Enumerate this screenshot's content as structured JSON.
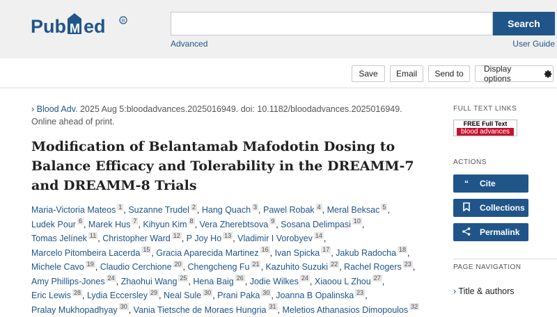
{
  "header": {
    "logo_text": "PubMed",
    "search_placeholder": "",
    "search_button": "Search",
    "advanced_link": "Advanced",
    "user_guide_link": "User Guide"
  },
  "toolbar": {
    "save": "Save",
    "email": "Email",
    "send_to": "Send to",
    "display_options": "Display options"
  },
  "citation": {
    "journal": "Blood Adv.",
    "details": " 2025 Aug 5:bloodadvances.2025016949. doi: 10.1182/bloodadvances.2025016949.",
    "status": "Online ahead of print."
  },
  "article": {
    "title": "Modification of Belantamab Mafodotin Dosing to Balance Efficacy and Tolerability in the DREAMM-7 and DREAMM-8 Trials",
    "authors": [
      {
        "name": "Maria-Victoria Mateos",
        "aff": "1"
      },
      {
        "name": "Suzanne Trudel",
        "aff": "2"
      },
      {
        "name": "Hang Quach",
        "aff": "3"
      },
      {
        "name": "Pawel Robak",
        "aff": "4"
      },
      {
        "name": "Meral Beksac",
        "aff": "5"
      },
      {
        "name": "Ludek Pour",
        "aff": "6"
      },
      {
        "name": "Marek Hus",
        "aff": "7"
      },
      {
        "name": "Kihyun Kim",
        "aff": "8"
      },
      {
        "name": "Vera Zherebtsova",
        "aff": "9"
      },
      {
        "name": "Sosana Delimpasi",
        "aff": "10"
      },
      {
        "name": "Tomas Jelínek",
        "aff": "11"
      },
      {
        "name": "Christopher Ward",
        "aff": "12"
      },
      {
        "name": "P Joy Ho",
        "aff": "13"
      },
      {
        "name": "Vladimir I Vorobyev",
        "aff": "14"
      },
      {
        "name": "Marcelo Pitombeira Lacerda",
        "aff": "15"
      },
      {
        "name": "Gracia Aparecida Martinez",
        "aff": "16"
      },
      {
        "name": "Ivan Spicka",
        "aff": "17"
      },
      {
        "name": "Jakub Radocha",
        "aff": "18"
      },
      {
        "name": "Michele Cavo",
        "aff": "19"
      },
      {
        "name": "Claudio Cerchione",
        "aff": "20"
      },
      {
        "name": "Chengcheng Fu",
        "aff": "21"
      },
      {
        "name": "Kazuhito Suzuki",
        "aff": "22"
      },
      {
        "name": "Rachel Rogers",
        "aff": "23"
      },
      {
        "name": "Amy Phillips-Jones",
        "aff": "24"
      },
      {
        "name": "Zhaohui Wang",
        "aff": "25"
      },
      {
        "name": "Hena Baig",
        "aff": "26"
      },
      {
        "name": "Jodie Wilkes",
        "aff": "24"
      },
      {
        "name": "Xiaoou L Zhou",
        "aff": "27"
      },
      {
        "name": "Eric Lewis",
        "aff": "28"
      },
      {
        "name": "Lydia Eccersley",
        "aff": "29"
      },
      {
        "name": "Neal Sule",
        "aff": "30"
      },
      {
        "name": "Prani Paka",
        "aff": "30"
      },
      {
        "name": "Joanna B Opalinska",
        "aff": "23"
      },
      {
        "name": "Pralay Mukhopadhyay",
        "aff": "30"
      },
      {
        "name": "Vania Tietsche de Moraes Hungria",
        "aff": "31"
      },
      {
        "name": "Meletios Athanasios Dimopoulos",
        "aff": "32"
      }
    ]
  },
  "sidebar": {
    "full_text_links_label": "FULL TEXT LINKS",
    "full_text_badge_line1": "FREE Full Text",
    "full_text_badge_line2": "blood advances",
    "actions_label": "ACTIONS",
    "cite": "Cite",
    "collections": "Collections",
    "permalink": "Permalink",
    "page_navigation_label": "PAGE NAVIGATION",
    "nav_title_authors": "Title & authors"
  },
  "colors": {
    "brand": "#20558a",
    "header_bg": "#f0f0f0"
  }
}
